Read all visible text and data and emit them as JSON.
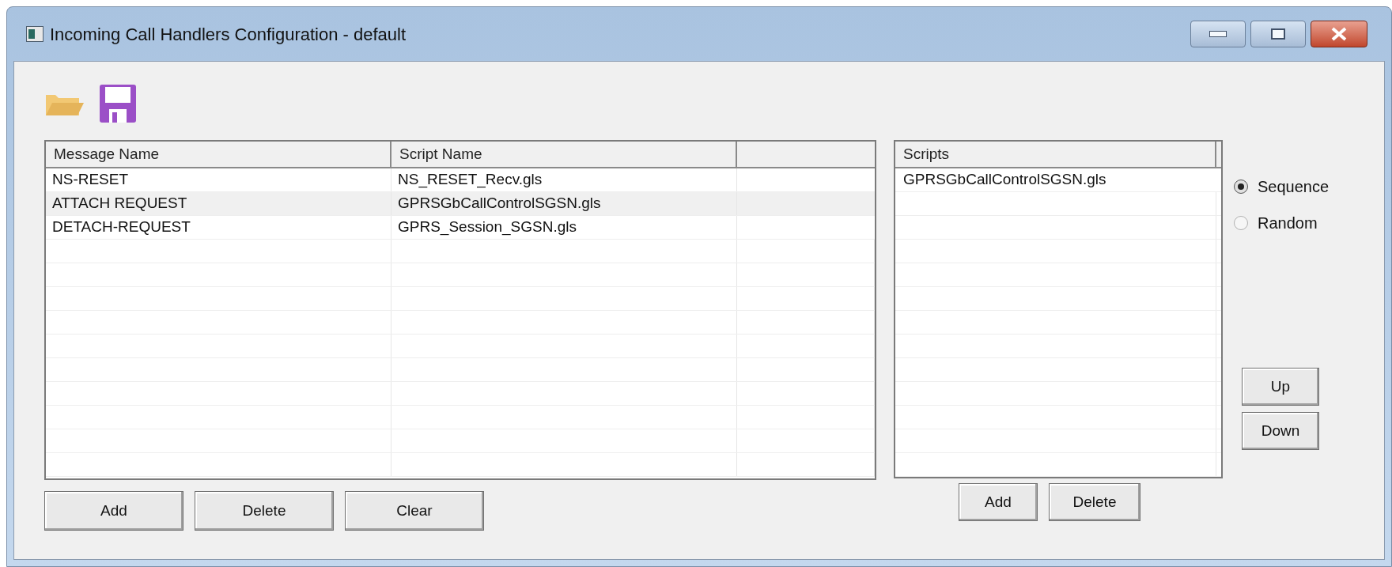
{
  "window": {
    "title": "Incoming Call Handlers Configuration - default"
  },
  "handlers_table": {
    "columns": [
      "Message Name",
      "Script Name"
    ],
    "rows": [
      {
        "message_name": "NS-RESET",
        "script_name": "NS_RESET_Recv.gls",
        "selected": false
      },
      {
        "message_name": "ATTACH REQUEST",
        "script_name": "GPRSGbCallControlSGSN.gls",
        "selected": true
      },
      {
        "message_name": "DETACH-REQUEST",
        "script_name": "GPRS_Session_SGSN.gls",
        "selected": false
      }
    ],
    "buttons": [
      "Add",
      "Delete",
      "Clear"
    ]
  },
  "scripts_list": {
    "column": "Scripts",
    "items": [
      {
        "label": "GPRSGbCallControlSGSN.gls",
        "selected": false
      }
    ],
    "buttons": [
      "Add",
      "Delete"
    ]
  },
  "order": [
    {
      "label": "Sequence",
      "selected": true
    },
    {
      "label": "Random",
      "selected": false
    }
  ],
  "move_buttons": [
    "Up",
    "Down"
  ]
}
